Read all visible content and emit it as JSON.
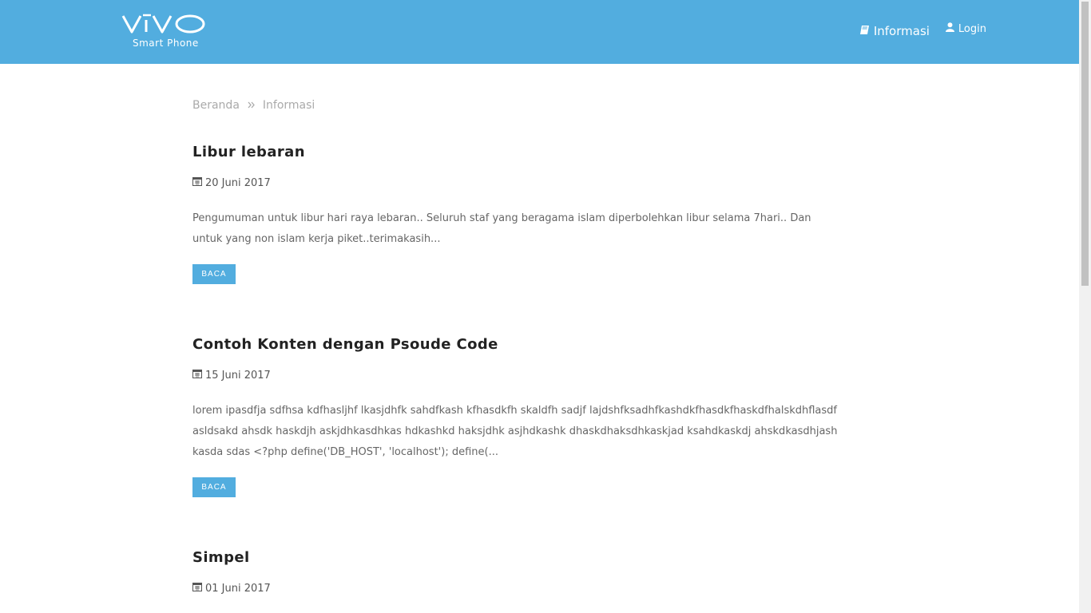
{
  "brand": {
    "logo_text": "vivo",
    "tagline": "Smart Phone"
  },
  "nav": {
    "informasi_label": "Informasi",
    "informasi_icon": "book-icon",
    "login_label": "Login",
    "login_icon": "user-icon"
  },
  "breadcrumb": {
    "items": [
      {
        "label": "Beranda"
      },
      {
        "label": "Informasi"
      }
    ],
    "separator_icon": "double-chevron-right-icon"
  },
  "posts": [
    {
      "title": "Libur lebaran",
      "date": "20 Juni 2017",
      "excerpt": "Pengumuman untuk libur hari raya lebaran.. Seluruh staf yang beragama islam diperbolehkan libur selama 7hari.. Dan untuk yang non islam kerja piket..terimakasih...",
      "button_label": "BACA"
    },
    {
      "title": "Contoh Konten dengan Psoude Code",
      "date": "15 Juni 2017",
      "excerpt": "lorem ipasdfja sdfhsa kdfhasljhf lkasjdhfk sahdfkash kfhasdkfh skaldfh sadjf lajdshfksadhfkashdkfhasdkfhaskdfhalskdhflasdf asldsakd ahsdk haskdjh askjdhkasdhkas hdkashkd haksjdhk asjhdkashk dhaskdhaksdhkaskjad ksahdkaskdj ahskdkasdhjash kasda sdas <?php define('DB_HOST', 'localhost'); define(...",
      "button_label": "BACA"
    },
    {
      "title": "Simpel",
      "date": "01 Juni 2017"
    }
  ],
  "colors": {
    "header": "#52addf",
    "button": "#52addf",
    "title": "#222222",
    "text": "#666666"
  }
}
